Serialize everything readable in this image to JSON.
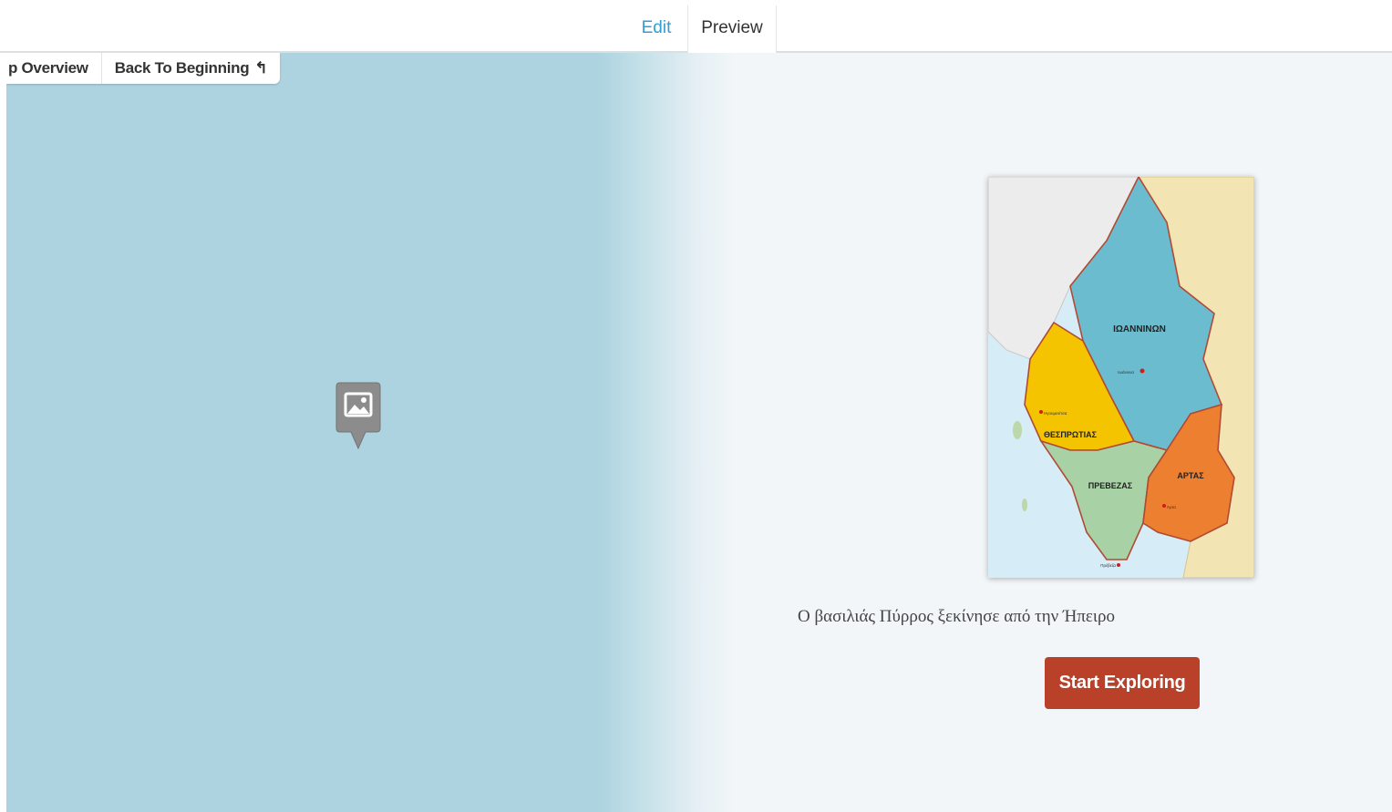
{
  "tabs": {
    "edit": "Edit",
    "preview": "Preview"
  },
  "breadcrumb": {
    "overview": "p Overview",
    "back": "Back To Beginning"
  },
  "map": {
    "regions": [
      "ΙΩΑΝΝΙΝΩΝ",
      "ΘΕΣΠΡΩΤΙΑΣ",
      "ΠΡΕΒΕΖΑΣ",
      "ΑΡΤΑΣ"
    ],
    "cities": [
      "Ιωάννινα",
      "Ηγουμενίτσα",
      "Άρτα",
      "Πρέβεζα"
    ]
  },
  "intro": {
    "caption": "Ο βασιλιάς Πύρρος ξεκίνησε από την Ήπειρο",
    "button": "Start Exploring"
  },
  "colors": {
    "accent": "#2f9fd0",
    "button": "#b9412a",
    "water": "#acd3df"
  },
  "icons": {
    "marker": "image-marker-icon",
    "back": "back-arrow-icon"
  }
}
